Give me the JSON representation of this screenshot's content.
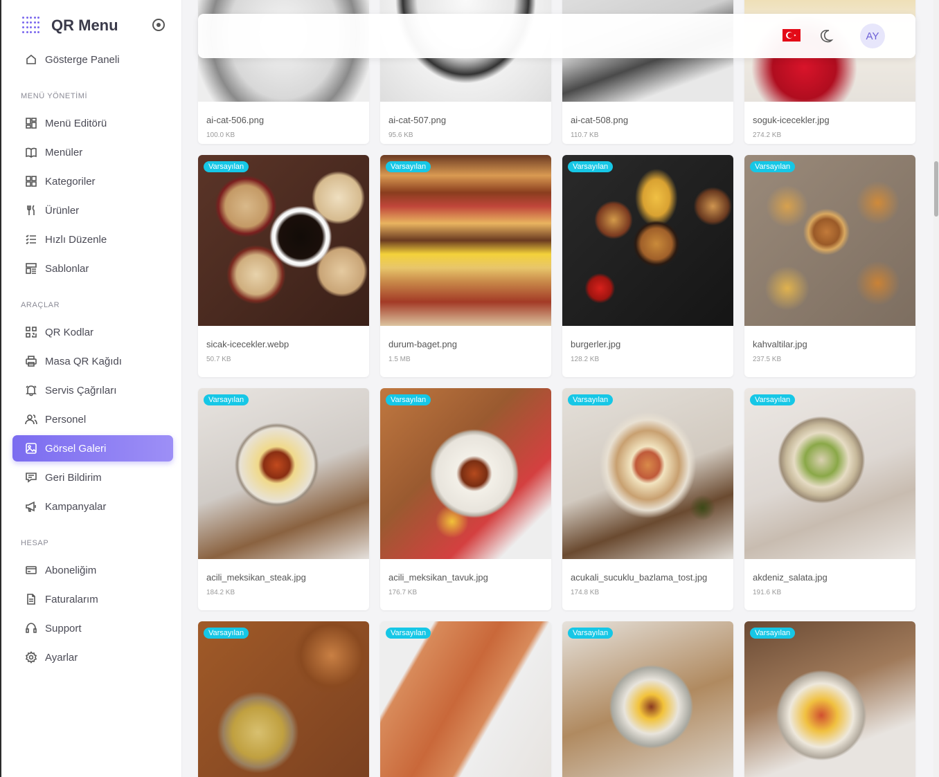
{
  "app": {
    "title": "QR Menu"
  },
  "sidebar": {
    "dashboard": "Gösterge Paneli",
    "sections": {
      "menu": "MENÜ YÖNETİMİ",
      "tools": "ARAÇLAR",
      "account": "HESAP"
    },
    "items": [
      {
        "label": "Menü Editörü",
        "icon": "grid-icon"
      },
      {
        "label": "Menüler",
        "icon": "book-icon"
      },
      {
        "label": "Kategoriler",
        "icon": "squares-icon"
      },
      {
        "label": "Ürünler",
        "icon": "cutlery-icon"
      },
      {
        "label": "Hızlı Düzenle",
        "icon": "list-check-icon"
      },
      {
        "label": "Sablonlar",
        "icon": "template-icon"
      },
      {
        "label": "QR Kodlar",
        "icon": "qr-icon"
      },
      {
        "label": "Masa QR Kağıdı",
        "icon": "printer-icon"
      },
      {
        "label": "Servis Çağrıları",
        "icon": "bell-icon"
      },
      {
        "label": "Personel",
        "icon": "users-icon"
      },
      {
        "label": "Görsel Galeri",
        "icon": "image-icon"
      },
      {
        "label": "Geri Bildirim",
        "icon": "feedback-icon"
      },
      {
        "label": "Kampanyalar",
        "icon": "megaphone-icon"
      },
      {
        "label": "Aboneliğim",
        "icon": "card-icon"
      },
      {
        "label": "Faturalarım",
        "icon": "invoice-icon"
      },
      {
        "label": "Support",
        "icon": "headset-icon"
      },
      {
        "label": "Ayarlar",
        "icon": "gear-icon"
      }
    ]
  },
  "header": {
    "avatar": "AY",
    "flag": "turkey-flag-icon",
    "theme": "moon-icon"
  },
  "gallery": {
    "badge": "Varsayılan",
    "row1": [
      {
        "name": "ai-cat-506.png",
        "size": "100.0 KB"
      },
      {
        "name": "ai-cat-507.png",
        "size": "95.6 KB"
      },
      {
        "name": "ai-cat-508.png",
        "size": "110.7 KB"
      },
      {
        "name": "soguk-icecekler.jpg",
        "size": "274.2 KB"
      }
    ],
    "row2": [
      {
        "name": "sicak-icecekler.webp",
        "size": "50.7 KB"
      },
      {
        "name": "durum-baget.png",
        "size": "1.5 MB"
      },
      {
        "name": "burgerler.jpg",
        "size": "128.2 KB"
      },
      {
        "name": "kahvaltilar.jpg",
        "size": "237.5 KB"
      }
    ],
    "row3": [
      {
        "name": "acili_meksikan_steak.jpg",
        "size": "184.2 KB"
      },
      {
        "name": "acili_meksikan_tavuk.jpg",
        "size": "176.7 KB"
      },
      {
        "name": "acukali_sucuklu_bazlama_tost.jpg",
        "size": "174.8 KB"
      },
      {
        "name": "akdeniz_salata.jpg",
        "size": "191.6 KB"
      }
    ]
  },
  "colors": {
    "accent": "#7b6cf0",
    "badge": "#16c7e6"
  }
}
